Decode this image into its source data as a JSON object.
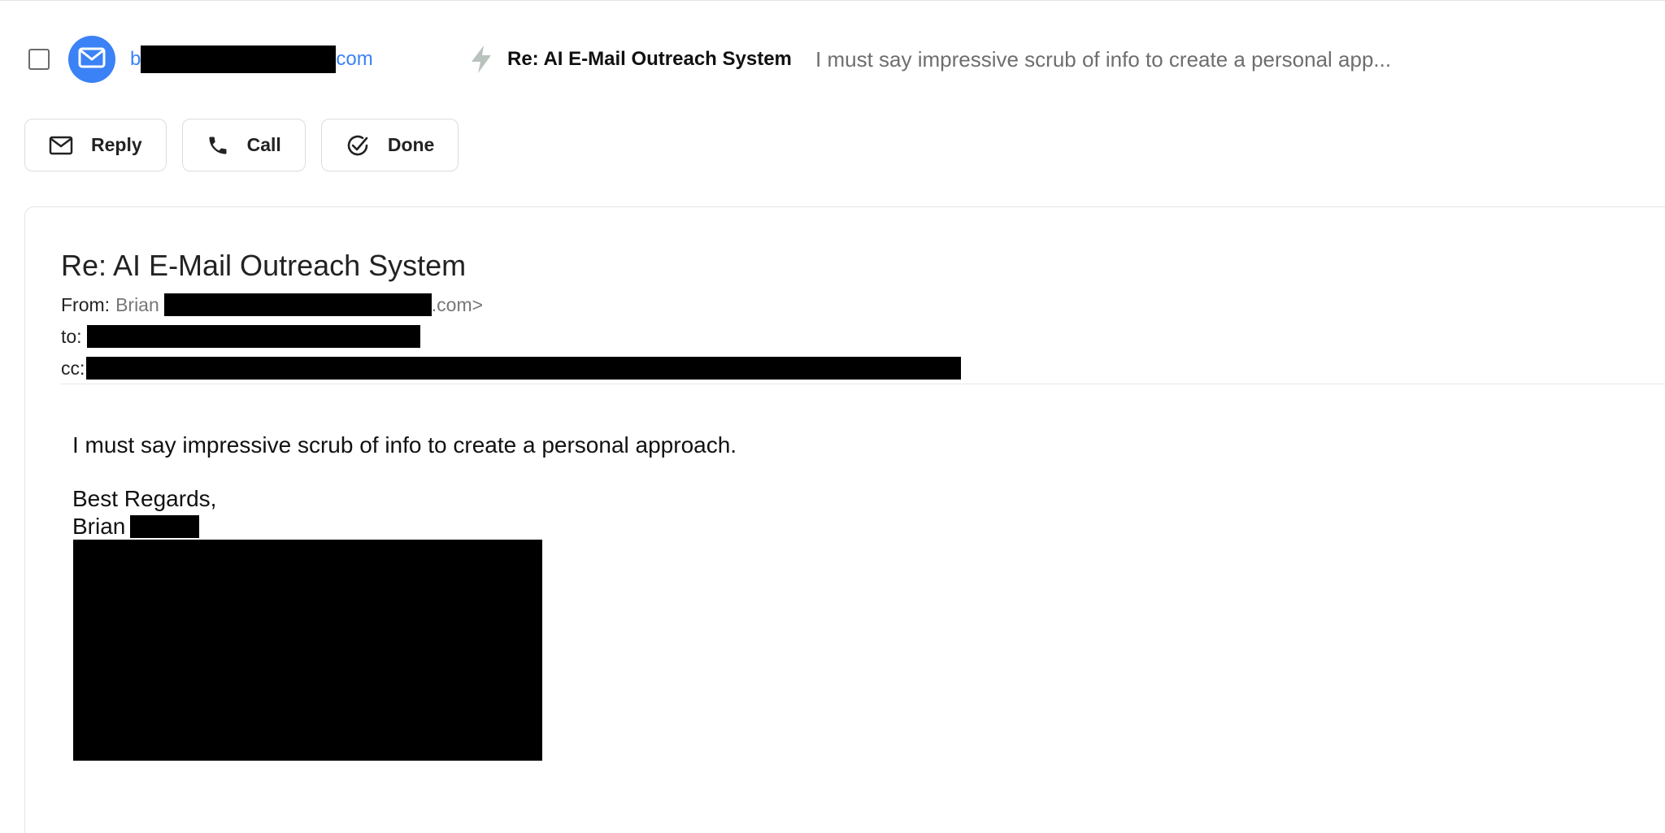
{
  "thread": {
    "sender_prefix": "b",
    "sender_suffix": "com",
    "subject": "Re: AI E-Mail Outreach System",
    "snippet": "I must say impressive scrub of info to create a personal app..."
  },
  "actions": {
    "reply_label": "Reply",
    "call_label": "Call",
    "done_label": "Done"
  },
  "message": {
    "title": "Re: AI E-Mail Outreach System",
    "from_label": "From:",
    "from_name": "Brian",
    "from_suffix": ".com>",
    "to_label": "to:",
    "cc_label": "cc:",
    "body_line1": "I must say impressive scrub of info to create a personal approach.",
    "signoff": "Best Regards,",
    "signature_name": "Brian"
  },
  "colors": {
    "accent": "#3b82f6",
    "redaction": "#000000",
    "bolt": "#b9c3bd"
  },
  "icons": {
    "avatar": "mail-icon",
    "priority": "bolt-icon",
    "reply": "mail-icon",
    "call": "phone-icon",
    "done": "check-circle-icon"
  }
}
